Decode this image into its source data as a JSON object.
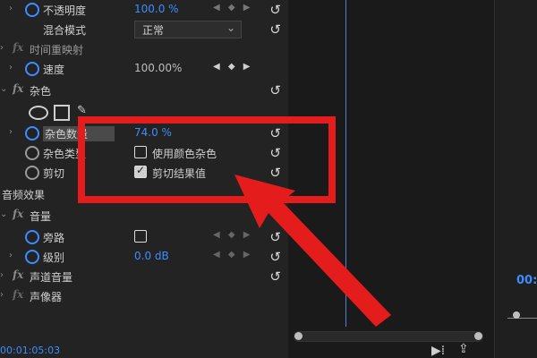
{
  "rows": [
    {
      "label": "不透明度",
      "value": "100.0 %"
    },
    {
      "label": "混合模式",
      "dropdown": "正常"
    },
    {
      "label": "时间重映射",
      "section": true
    },
    {
      "label": "速度",
      "value": "100.00%"
    },
    {
      "label": "杂色",
      "section": true
    },
    {
      "label": "杂色数量",
      "value": "74.0 %"
    },
    {
      "label": "杂色类型",
      "checkbox_label": "使用颜色杂色"
    },
    {
      "label": "剪切",
      "checkbox_label": "剪切结果值"
    },
    {
      "label": "音频效果",
      "category": true
    },
    {
      "label": "音量",
      "section": true
    },
    {
      "label": "旁路"
    },
    {
      "label": "级别",
      "value": "0.0 dB"
    },
    {
      "label": "声道音量",
      "section": true
    },
    {
      "label": "声像器",
      "section": true
    }
  ],
  "timecode": "00:01:05:03",
  "right_timecode": "00:",
  "colors": {
    "accent": "#3d8cff",
    "annotation": "#e51c1c",
    "panel": "#232323",
    "timeline": "#1a1a1a"
  },
  "icons": [
    "stopwatch-icon",
    "reset-icon",
    "keyframe-nav-icon",
    "fx-icon",
    "ellipse-mask-icon",
    "rectangle-mask-icon",
    "pen-mask-icon",
    "arrow-annotation-icon",
    "export-icon",
    "wrench-icon"
  ]
}
